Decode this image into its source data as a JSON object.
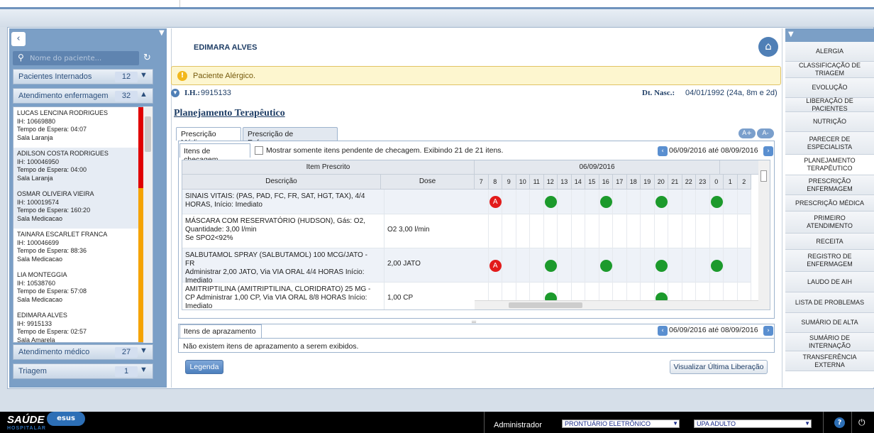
{
  "patient_panel": {
    "search_placeholder": "Nome do paciente...",
    "groups": [
      {
        "label": "Pacientes Internados",
        "count": "12"
      },
      {
        "label": "Atendimento enfermagem",
        "count": "32"
      },
      {
        "label": "Atendimento médico",
        "count": "27"
      },
      {
        "label": "Triagem",
        "count": "1"
      }
    ],
    "patients": [
      {
        "name": "LUCAS LENCINA RODRIGUES",
        "ih": "IH: 10669880",
        "wait": "Tempo de Espera: 04:07",
        "room": "Sala Laranja",
        "status_color": "#e00000"
      },
      {
        "name": "ADILSON COSTA RODRIGUES",
        "ih": "IH: 100046950",
        "wait": "Tempo de Espera: 04:00",
        "room": "Sala Laranja",
        "status_color": "#e00000"
      },
      {
        "name": "OSMAR OLIVEIRA VIEIRA",
        "ih": "IH: 100019574",
        "wait": "Tempo de Espera: 160:20",
        "room": "Sala Medicacao",
        "status_color": "#f5a300"
      },
      {
        "name": "TAINARA ESCARLET FRANCA",
        "ih": "IH: 100046699",
        "wait": "Tempo de Espera: 88:36",
        "room": "Sala Medicacao",
        "status_color": "#f5a300"
      },
      {
        "name": "LIA MONTEGGIA",
        "ih": "IH: 10538760",
        "wait": "Tempo de Espera: 57:08",
        "room": "Sala Medicacao",
        "status_color": "#f5a300"
      },
      {
        "name": "EDIMARA ALVES",
        "ih": "IH: 9915133",
        "wait": "Tempo de Espera: 02:57",
        "room": "Sala Amarela",
        "status_color": "#f5a300"
      }
    ]
  },
  "header": {
    "patient_name": "EDIMARA ALVES",
    "alert": "Paciente Alérgico.",
    "ih_label": "I.H.:",
    "ih_value": "9915133",
    "dob_label": "Dt. Nasc.:",
    "dob_value": "04/01/1992 (24a, 8m e 2d)"
  },
  "main": {
    "title": "Planejamento Terapêutico",
    "tabs": [
      "Prescrição Médica",
      "Prescrição de Enfermagem"
    ],
    "font_plus": "A+",
    "font_minus": "A-",
    "checks_tab": "Itens de checagem",
    "checkbox_label": "Mostrar somente itens pendente de checagem. Exibindo 21 de 21 itens.",
    "date_range": "06/09/2016 até 08/09/2016",
    "grid": {
      "group_header": "Item Prescrito",
      "col_desc": "Descrição",
      "col_dose": "Dose",
      "date": "06/09/2016",
      "hours": [
        "7",
        "8",
        "9",
        "10",
        "11",
        "12",
        "13",
        "14",
        "15",
        "16",
        "17",
        "18",
        "19",
        "20",
        "21",
        "22",
        "23",
        "0",
        "1",
        "2"
      ],
      "rows": [
        {
          "lines": [
            "SINAIS VITAIS: (PAS, PAD, FC, FR, SAT, HGT, TAX), 4/4",
            "HORAS, Início: Imediato"
          ],
          "dose": ""
        },
        {
          "lines": [
            "MÁSCARA COM RESERVATÓRIO (HUDSON), Gás: O2,",
            "Quantidade: 3,00 l/min",
            "Se SPO2<92%"
          ],
          "dose": "O2 3,00 l/min"
        },
        {
          "lines": [
            "SALBUTAMOL SPRAY (SALBUTAMOL) 100 MCG/JATO - FR",
            "Administrar 2,00 JATO, Via VIA ORAL 4/4 HORAS Início:",
            "Imediato"
          ],
          "dose": "2,00 JATO"
        },
        {
          "lines": [
            "AMITRIPTILINA (AMITRIPTILINA, CLORIDRATO) 25 MG -",
            "CP Administrar 1,00 CP, Via VIA ORAL 8/8 HORAS Início:",
            "Imediato"
          ],
          "dose": "1,00 CP"
        }
      ],
      "schedule_marks": [
        {
          "row": 0,
          "hour": "8",
          "kind": "pending",
          "label": "A"
        },
        {
          "row": 0,
          "hour": "12",
          "kind": "done"
        },
        {
          "row": 0,
          "hour": "16",
          "kind": "done"
        },
        {
          "row": 0,
          "hour": "20",
          "kind": "done"
        },
        {
          "row": 0,
          "hour": "0",
          "kind": "done"
        },
        {
          "row": 2,
          "hour": "8",
          "kind": "pending",
          "label": "A"
        },
        {
          "row": 2,
          "hour": "12",
          "kind": "done"
        },
        {
          "row": 2,
          "hour": "16",
          "kind": "done"
        },
        {
          "row": 2,
          "hour": "20",
          "kind": "done"
        },
        {
          "row": 2,
          "hour": "0",
          "kind": "done"
        },
        {
          "row": 3,
          "hour": "12",
          "kind": "done"
        },
        {
          "row": 3,
          "hour": "20",
          "kind": "done"
        }
      ]
    },
    "apraz_tab": "Itens de aprazamento",
    "apraz_empty": "Não existem itens de aprazamento a serem exibidos.",
    "legend_button": "Legenda",
    "last_release_button": "Visualizar Última Liberação"
  },
  "right_menu": [
    "ALERGIA",
    "CLASSIFICAÇÃO DE TRIAGEM",
    "EVOLUÇÃO",
    "LIBERAÇÃO DE PACIENTES",
    "NUTRIÇÃO",
    "PARECER DE ESPECIALISTA",
    "PLANEJAMENTO TERAPÊUTICO",
    "PRESCRIÇÃO ENFERMAGEM",
    "PRESCRIÇÃO MÉDICA",
    "PRIMEIRO ATENDIMENTO",
    "RECEITA",
    "REGISTRO DE ENFERMAGEM",
    "LAUDO DE AIH",
    "LISTA DE PROBLEMAS",
    "SUMÁRIO DE ALTA",
    "SUMÁRIO DE INTERNAÇÃO",
    "TRANSFERÊNCIA EXTERNA"
  ],
  "footer": {
    "logo_line1": "SAÚDE",
    "logo_badge": "sus",
    "logo_line2": "HOSPITALAR",
    "user": "Administrador",
    "module": "PRONTUÁRIO ELETRÔNICO",
    "unit": "UPA ADULTO"
  },
  "colors": {
    "done": "#1c9a2c",
    "pending": "#e21b1b",
    "accent": "#1f3e66"
  }
}
